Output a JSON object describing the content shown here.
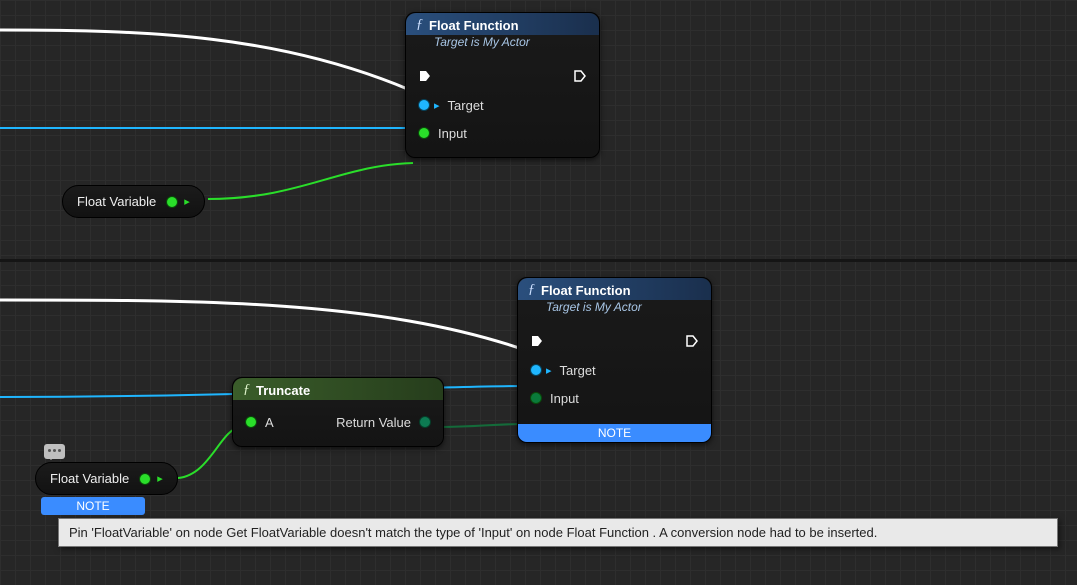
{
  "top": {
    "floatFunction": {
      "title": "Float Function",
      "subtitle": "Target is My Actor",
      "pins": {
        "target": "Target",
        "input": "Input"
      }
    },
    "variable": {
      "label": "Float Variable"
    }
  },
  "bottom": {
    "floatFunction": {
      "title": "Float Function",
      "subtitle": "Target is My Actor",
      "pins": {
        "target": "Target",
        "input": "Input"
      },
      "note": "NOTE"
    },
    "truncate": {
      "title": "Truncate",
      "pins": {
        "a": "A",
        "return": "Return Value"
      }
    },
    "variable": {
      "label": "Float Variable",
      "note": "NOTE"
    }
  },
  "tooltip": "Pin 'FloatVariable' on node  Get FloatVariable  doesn't match the type of 'Input' on node  Float Function . A conversion node had to be inserted."
}
